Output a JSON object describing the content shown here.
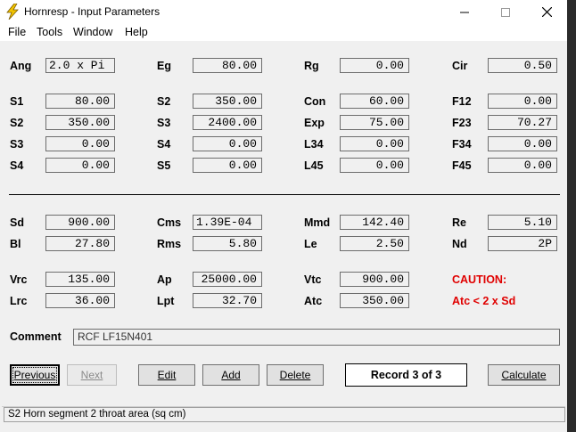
{
  "window": {
    "title": "Hornresp - Input Parameters"
  },
  "menu": [
    "File",
    "Tools",
    "Window",
    "Help"
  ],
  "params": {
    "ang": {
      "label": "Ang",
      "value": "2.0 x Pi"
    },
    "eg": {
      "label": "Eg",
      "value": "80.00"
    },
    "rg": {
      "label": "Rg",
      "value": "0.00"
    },
    "cir": {
      "label": "Cir",
      "value": "0.50"
    },
    "s1": {
      "label": "S1",
      "value": "80.00"
    },
    "s2a": {
      "label": "S2",
      "value": "350.00"
    },
    "con": {
      "label": "Con",
      "value": "60.00"
    },
    "f12": {
      "label": "F12",
      "value": "0.00"
    },
    "s2": {
      "label": "S2",
      "value": "350.00"
    },
    "s3a": {
      "label": "S3",
      "value": "2400.00"
    },
    "exp": {
      "label": "Exp",
      "value": "75.00"
    },
    "f23": {
      "label": "F23",
      "value": "70.27"
    },
    "s3": {
      "label": "S3",
      "value": "0.00"
    },
    "s4a": {
      "label": "S4",
      "value": "0.00"
    },
    "l34": {
      "label": "L34",
      "value": "0.00"
    },
    "f34": {
      "label": "F34",
      "value": "0.00"
    },
    "s4": {
      "label": "S4",
      "value": "0.00"
    },
    "s5": {
      "label": "S5",
      "value": "0.00"
    },
    "l45": {
      "label": "L45",
      "value": "0.00"
    },
    "f45": {
      "label": "F45",
      "value": "0.00"
    },
    "sd": {
      "label": "Sd",
      "value": "900.00"
    },
    "cms": {
      "label": "Cms",
      "value": "1.39E-04"
    },
    "mmd": {
      "label": "Mmd",
      "value": "142.40"
    },
    "re": {
      "label": "Re",
      "value": "5.10"
    },
    "bl": {
      "label": "Bl",
      "value": "27.80"
    },
    "rms": {
      "label": "Rms",
      "value": "5.80"
    },
    "le": {
      "label": "Le",
      "value": "2.50"
    },
    "nd": {
      "label": "Nd",
      "value": "2P"
    },
    "vrc": {
      "label": "Vrc",
      "value": "135.00"
    },
    "ap": {
      "label": "Ap",
      "value": "25000.00"
    },
    "vtc": {
      "label": "Vtc",
      "value": "900.00"
    },
    "lrc": {
      "label": "Lrc",
      "value": "36.00"
    },
    "lpt": {
      "label": "Lpt",
      "value": "32.70"
    },
    "atc": {
      "label": "Atc",
      "value": "350.00"
    }
  },
  "caution": {
    "title": "CAUTION:",
    "message": "Atc < 2 x Sd"
  },
  "comment": {
    "label": "Comment",
    "value": "RCF LF15N401"
  },
  "buttons": {
    "previous": "Previous",
    "next": "Next",
    "edit": "Edit",
    "add": "Add",
    "delete": "Delete",
    "calculate": "Calculate"
  },
  "record": "Record 3 of 3",
  "status": "S2   Horn segment 2 throat area  (sq cm)"
}
